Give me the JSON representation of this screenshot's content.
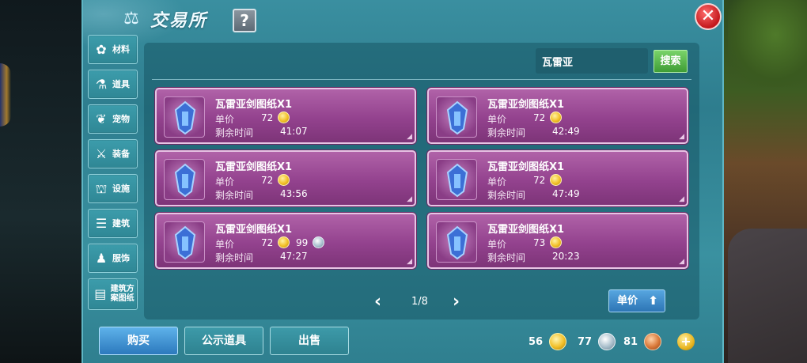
{
  "window": {
    "title": "交易所",
    "help_label": "?",
    "close_label": "✕"
  },
  "sidebar": {
    "items": [
      {
        "label": "材料",
        "icon": "materials-icon",
        "glyph": "✿"
      },
      {
        "label": "道具",
        "icon": "potion-icon",
        "glyph": "⚗"
      },
      {
        "label": "宠物",
        "icon": "paw-icon",
        "glyph": "❦"
      },
      {
        "label": "装备",
        "icon": "sword-icon",
        "glyph": "⚔"
      },
      {
        "label": "设施",
        "icon": "facility-icon",
        "glyph": "⛫"
      },
      {
        "label": "建筑",
        "icon": "building-icon",
        "glyph": "☰"
      },
      {
        "label": "服饰",
        "icon": "clothing-icon",
        "glyph": "♟"
      },
      {
        "label": "建筑方案图纸",
        "icon": "blueprint-icon",
        "glyph": "▤"
      }
    ]
  },
  "search": {
    "value": "瓦雷亚",
    "button_label": "搜索"
  },
  "listings": [
    {
      "name": "瓦雷亚剑图纸X1",
      "price_label": "单价",
      "price_gold": "72",
      "price_silver": "",
      "time_label": "剩余时间",
      "time": "41:07",
      "icon": "sword-blueprint-icon"
    },
    {
      "name": "瓦雷亚剑图纸X1",
      "price_label": "单价",
      "price_gold": "72",
      "price_silver": "",
      "time_label": "剩余时间",
      "time": "42:49",
      "icon": "sword-blueprint-icon"
    },
    {
      "name": "瓦雷亚剑图纸X1",
      "price_label": "单价",
      "price_gold": "72",
      "price_silver": "",
      "time_label": "剩余时间",
      "time": "43:56",
      "icon": "sword-blueprint-icon"
    },
    {
      "name": "瓦雷亚剑图纸X1",
      "price_label": "单价",
      "price_gold": "72",
      "price_silver": "",
      "time_label": "剩余时间",
      "time": "47:49",
      "icon": "sword-blueprint-icon"
    },
    {
      "name": "瓦雷亚剑图纸X1",
      "price_label": "单价",
      "price_gold": "72",
      "price_silver": "99",
      "time_label": "剩余时间",
      "time": "47:27",
      "icon": "sword-blueprint-icon"
    },
    {
      "name": "瓦雷亚剑图纸X1",
      "price_label": "单价",
      "price_gold": "73",
      "price_silver": "",
      "time_label": "剩余时间",
      "time": "20:23",
      "icon": "sword-blueprint-icon"
    }
  ],
  "pager": {
    "text": "1/8"
  },
  "sort": {
    "label": "单价"
  },
  "actions": {
    "buy": "购买",
    "public_items": "公示道具",
    "sell": "出售"
  },
  "currency": {
    "gold": "56",
    "silver": "77",
    "bronze": "81"
  },
  "colors": {
    "panel": "#3a8fa0",
    "card": "#a0529a",
    "search_button": "#5cb84c",
    "primary_button": "#3b8fd4"
  }
}
